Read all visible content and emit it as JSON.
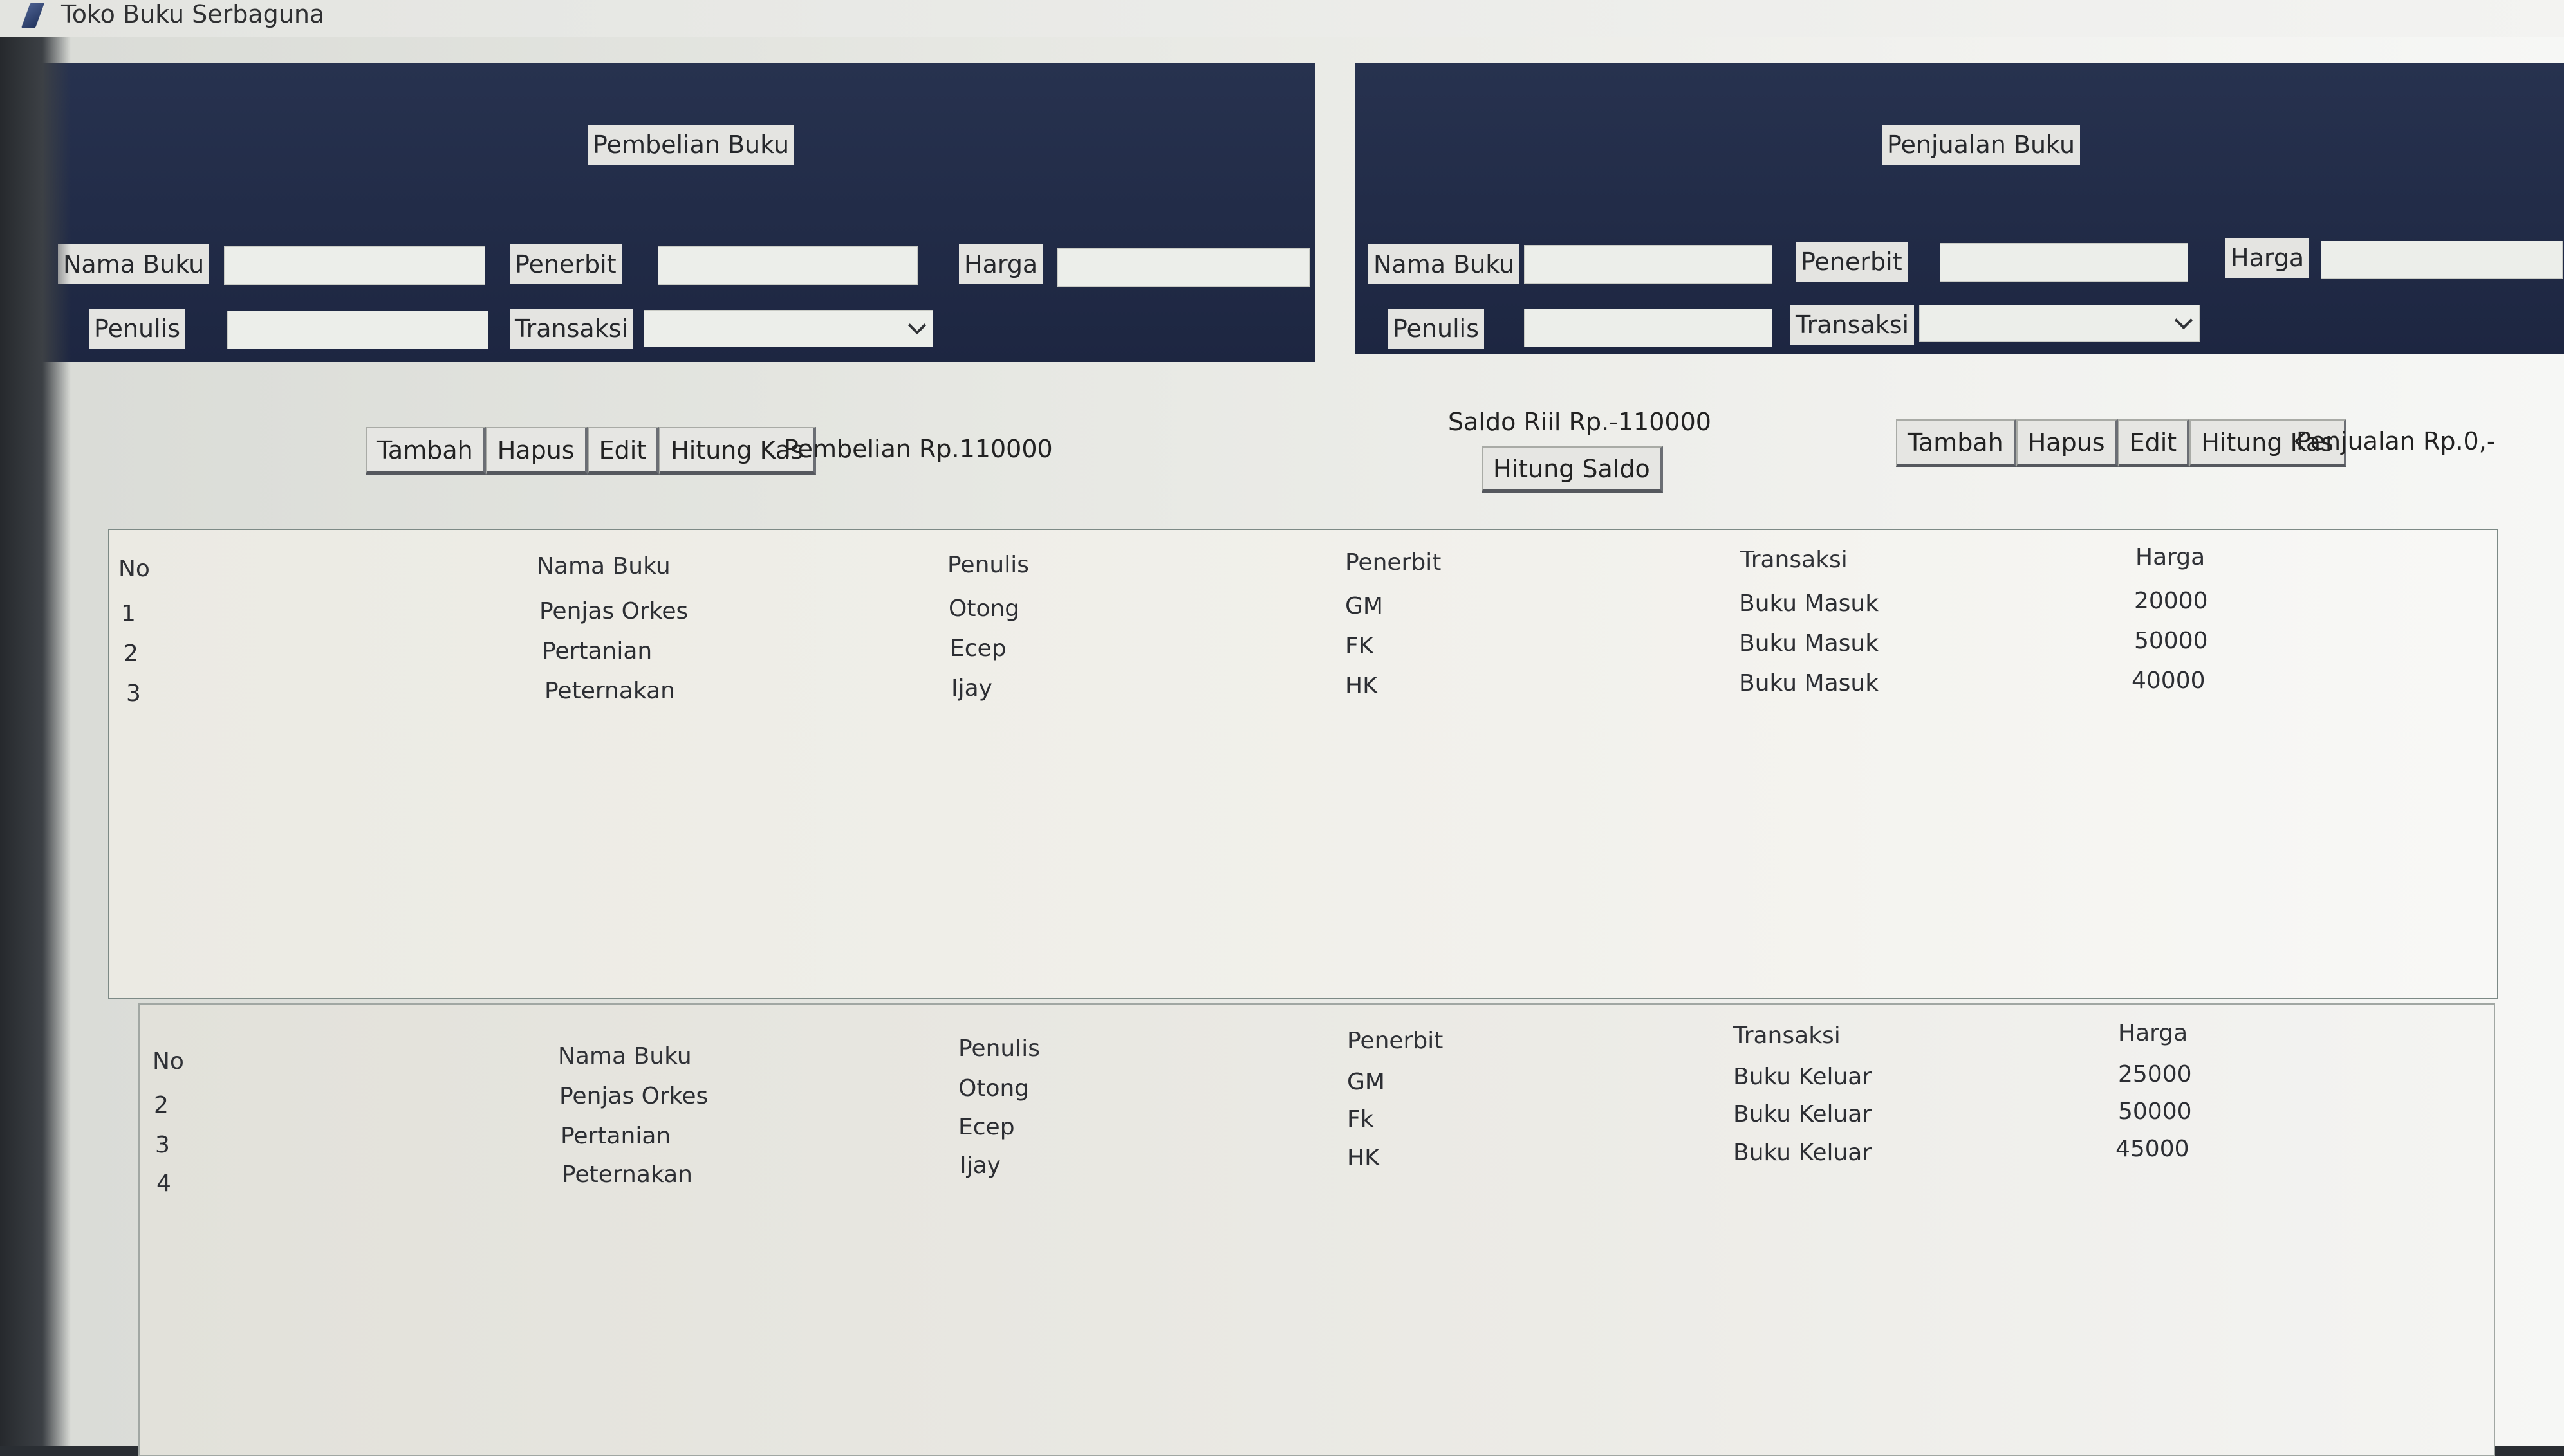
{
  "window": {
    "title": "Toko Buku Serbaguna"
  },
  "pembelian": {
    "heading": "Pembelian Buku",
    "labels": {
      "nama_buku": "Nama Buku",
      "penerbit": "Penerbit",
      "harga": "Harga",
      "penulis": "Penulis",
      "transaksi": "Transaksi"
    },
    "values": {
      "nama_buku": "",
      "penerbit": "",
      "harga": "",
      "penulis": "",
      "transaksi": ""
    },
    "buttons": {
      "tambah": "Tambah",
      "hapus": "Hapus",
      "edit": "Edit",
      "hitung_kas": "Hitung Kas"
    },
    "total": "Pembelian  Rp.110000"
  },
  "penjualan": {
    "heading": "Penjualan Buku",
    "labels": {
      "nama_buku": "Nama Buku",
      "penerbit": "Penerbit",
      "harga": "Harga",
      "penulis": "Penulis",
      "transaksi": "Transaksi"
    },
    "values": {
      "nama_buku": "",
      "penerbit": "",
      "harga": "",
      "penulis": "",
      "transaksi": ""
    },
    "buttons": {
      "tambah": "Tambah",
      "hapus": "Hapus",
      "edit": "Edit",
      "hitung_kas": "Hitung Kas"
    },
    "total": "Penjualan  Rp.0,-"
  },
  "saldo": {
    "text": "Saldo Riil  Rp.-110000",
    "button": "Hitung Saldo"
  },
  "table_pembelian": {
    "headers": [
      "No",
      "Nama Buku",
      "Penulis",
      "Penerbit",
      "Transaksi",
      "Harga"
    ],
    "rows": [
      [
        "1",
        "Penjas Orkes",
        "Otong",
        "GM",
        "Buku Masuk",
        "20000"
      ],
      [
        "2",
        "Pertanian",
        "Ecep",
        "FK",
        "Buku Masuk",
        "50000"
      ],
      [
        "3",
        "Peternakan",
        "Ijay",
        "HK",
        "Buku Masuk",
        "40000"
      ]
    ]
  },
  "table_penjualan": {
    "headers": [
      "No",
      "Nama Buku",
      "Penulis",
      "Penerbit",
      "Transaksi",
      "Harga"
    ],
    "rows": [
      [
        "2",
        "Penjas Orkes",
        "Otong",
        "GM",
        "Buku Keluar",
        "25000"
      ],
      [
        "3",
        "Pertanian",
        "Ecep",
        "Fk",
        "Buku Keluar",
        "50000"
      ],
      [
        "4",
        "Peternakan",
        "Ijay",
        "HK",
        "Buku Keluar",
        "45000"
      ]
    ]
  }
}
